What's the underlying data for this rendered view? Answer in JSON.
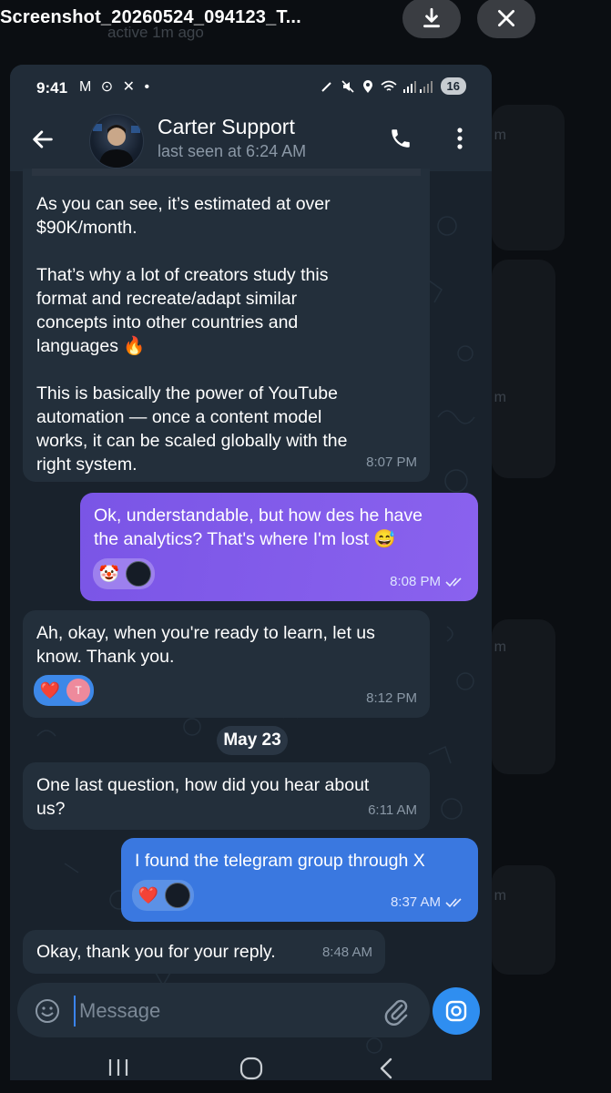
{
  "viewer": {
    "file_name": "Screenshot_20260524_094123_T...",
    "ghost_text": "active 1m ago",
    "download_icon": "download-icon",
    "close_icon": "close-icon"
  },
  "status_bar": {
    "time": "9:41",
    "left_icons": "M ⊙ ✕ •",
    "battery": "16"
  },
  "header": {
    "contact_name": "Carter Support",
    "last_seen": "last seen at 6:24 AM"
  },
  "messages": [
    {
      "direction": "in",
      "text": "As you can see, it’s estimated at over\n$90K/month.\n\nThat’s why a lot of creators study this\nformat and recreate/adapt similar\nconcepts into other countries and\nlanguages 🔥\n\nThis is basically the power of YouTube\nautomation — once a content model\nworks, it can be scaled globally with the\nright system.",
      "time": "8:07 PM"
    },
    {
      "direction": "out",
      "text": "Ok, understandable, but how des he have\nthe analytics? That's where I'm lost 😅",
      "time": "8:08 PM",
      "reactions": [
        "🤡"
      ]
    },
    {
      "direction": "in",
      "text": "Ah, okay, when you're ready to learn, let us\nknow. Thank you.",
      "time": "8:12 PM",
      "reactions": [
        "❤️"
      ],
      "reactor_initial": "T"
    },
    {
      "direction": "in",
      "text": "One last question, how did you hear about\nus?",
      "time": "6:11 AM"
    },
    {
      "direction": "out",
      "text": "I found the telegram group through X",
      "time": "8:37 AM",
      "reactions": [
        "❤️"
      ]
    },
    {
      "direction": "in",
      "text": "Okay, thank you for your reply.",
      "time": "8:48 AM"
    }
  ],
  "date_separator": "May 23",
  "composer": {
    "placeholder": "Message"
  },
  "colors": {
    "header_bg": "#212c38",
    "chat_bg": "#19222c",
    "incoming_bubble": "#232f3b",
    "outgoing_purple": "#7a55e6",
    "outgoing_blue": "#3a78e0",
    "accent": "#2f8ef0"
  }
}
